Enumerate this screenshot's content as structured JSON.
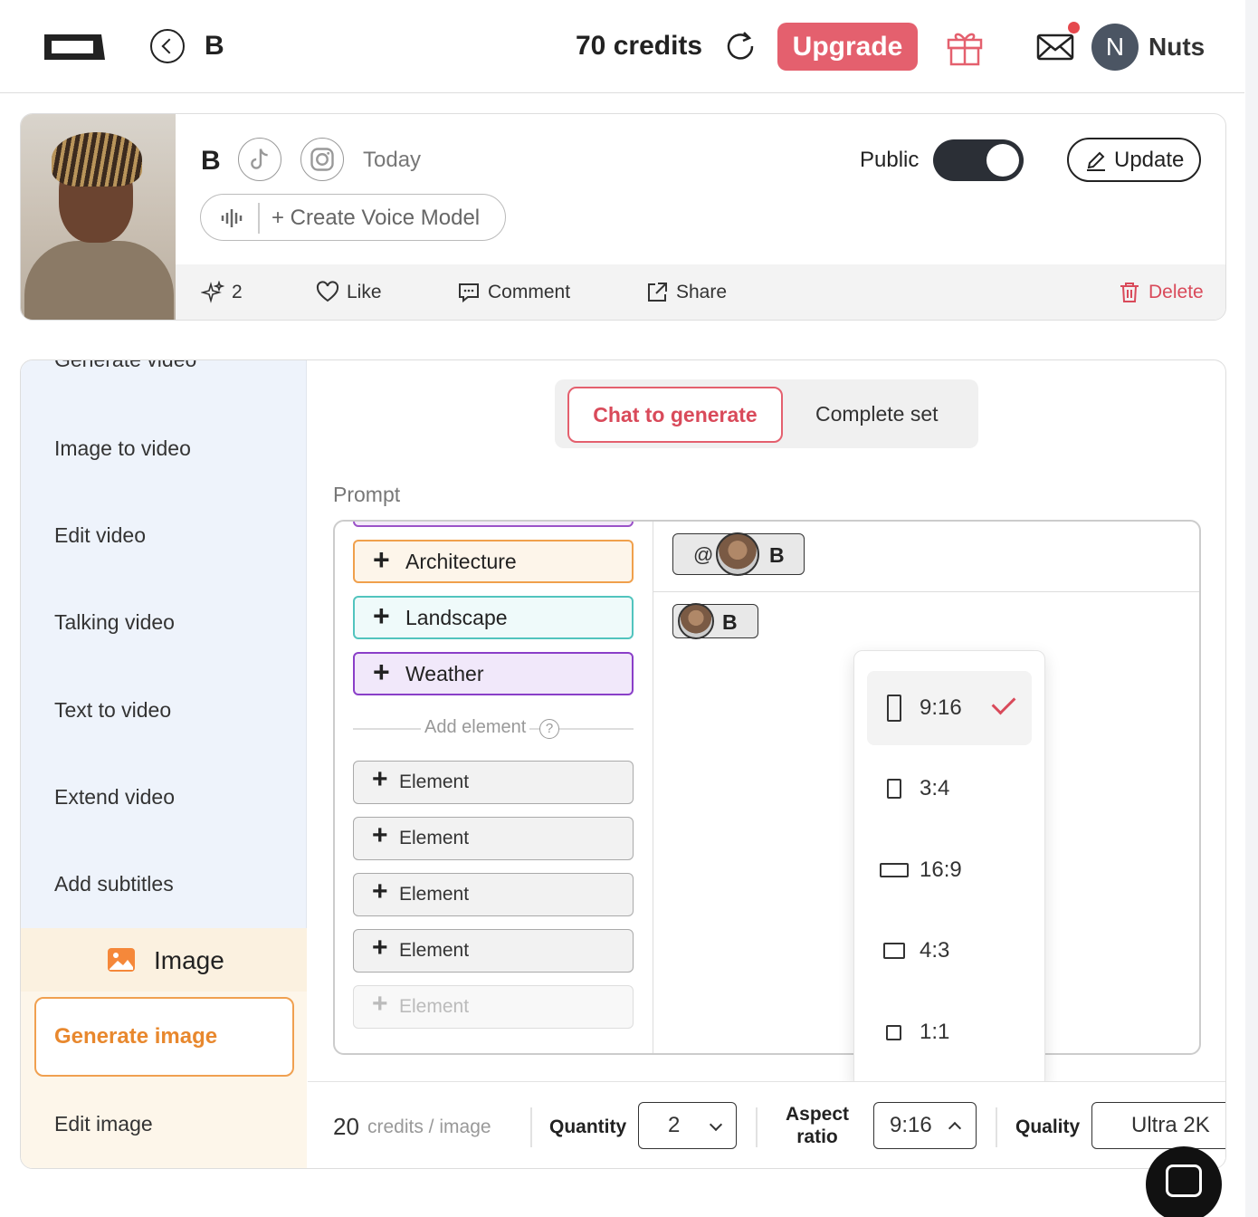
{
  "topbar": {
    "title": "B",
    "credits": "70 credits",
    "upgrade_label": "Upgrade",
    "avatar_initial": "N",
    "user_name": "Nuts",
    "icons": [
      "logo-icon",
      "back-icon",
      "refresh-icon",
      "gift-icon",
      "mail-icon"
    ]
  },
  "profile": {
    "name": "B",
    "date": "Today",
    "create_voice_label": "+ Create Voice Model",
    "public_label": "Public",
    "public_on": true,
    "update_label": "Update",
    "actions": {
      "generations_count": "2",
      "like_label": "Like",
      "comment_label": "Comment",
      "share_label": "Share",
      "delete_label": "Delete"
    }
  },
  "sidebar": {
    "cut_item": "Generate video",
    "items": [
      "Image to video",
      "Edit video",
      "Talking video",
      "Text to video",
      "Extend video",
      "Add subtitles"
    ],
    "image_section_title": "Image",
    "generate_image_label": "Generate image",
    "edit_image_label": "Edit image"
  },
  "mode": {
    "active_label": "Chat to generate",
    "other_label": "Complete set"
  },
  "prompt": {
    "label": "Prompt",
    "tags": [
      "Architecture",
      "Landscape",
      "Weather"
    ],
    "add_element_label": "Add element",
    "help_glyph": "?",
    "element_label": "Element",
    "chips": [
      {
        "prefix": "@",
        "name": "B"
      },
      {
        "name": "B"
      }
    ]
  },
  "aspect_dropdown": {
    "options": [
      "9:16",
      "3:4",
      "16:9",
      "4:3",
      "1:1"
    ],
    "selected": "9:16"
  },
  "bottom": {
    "cost_number": "20",
    "cost_unit": "credits / image",
    "quantity_label": "Quantity",
    "quantity_value": "2",
    "aspect_label_line1": "Aspect",
    "aspect_label_line2": "ratio",
    "aspect_value": "9:16",
    "quality_label": "Quality",
    "quality_value": "Ultra 2K"
  },
  "colors": {
    "accent_red": "#e4606e",
    "accent_orange": "#e8882e",
    "toggle_dark": "#2b2f36"
  }
}
